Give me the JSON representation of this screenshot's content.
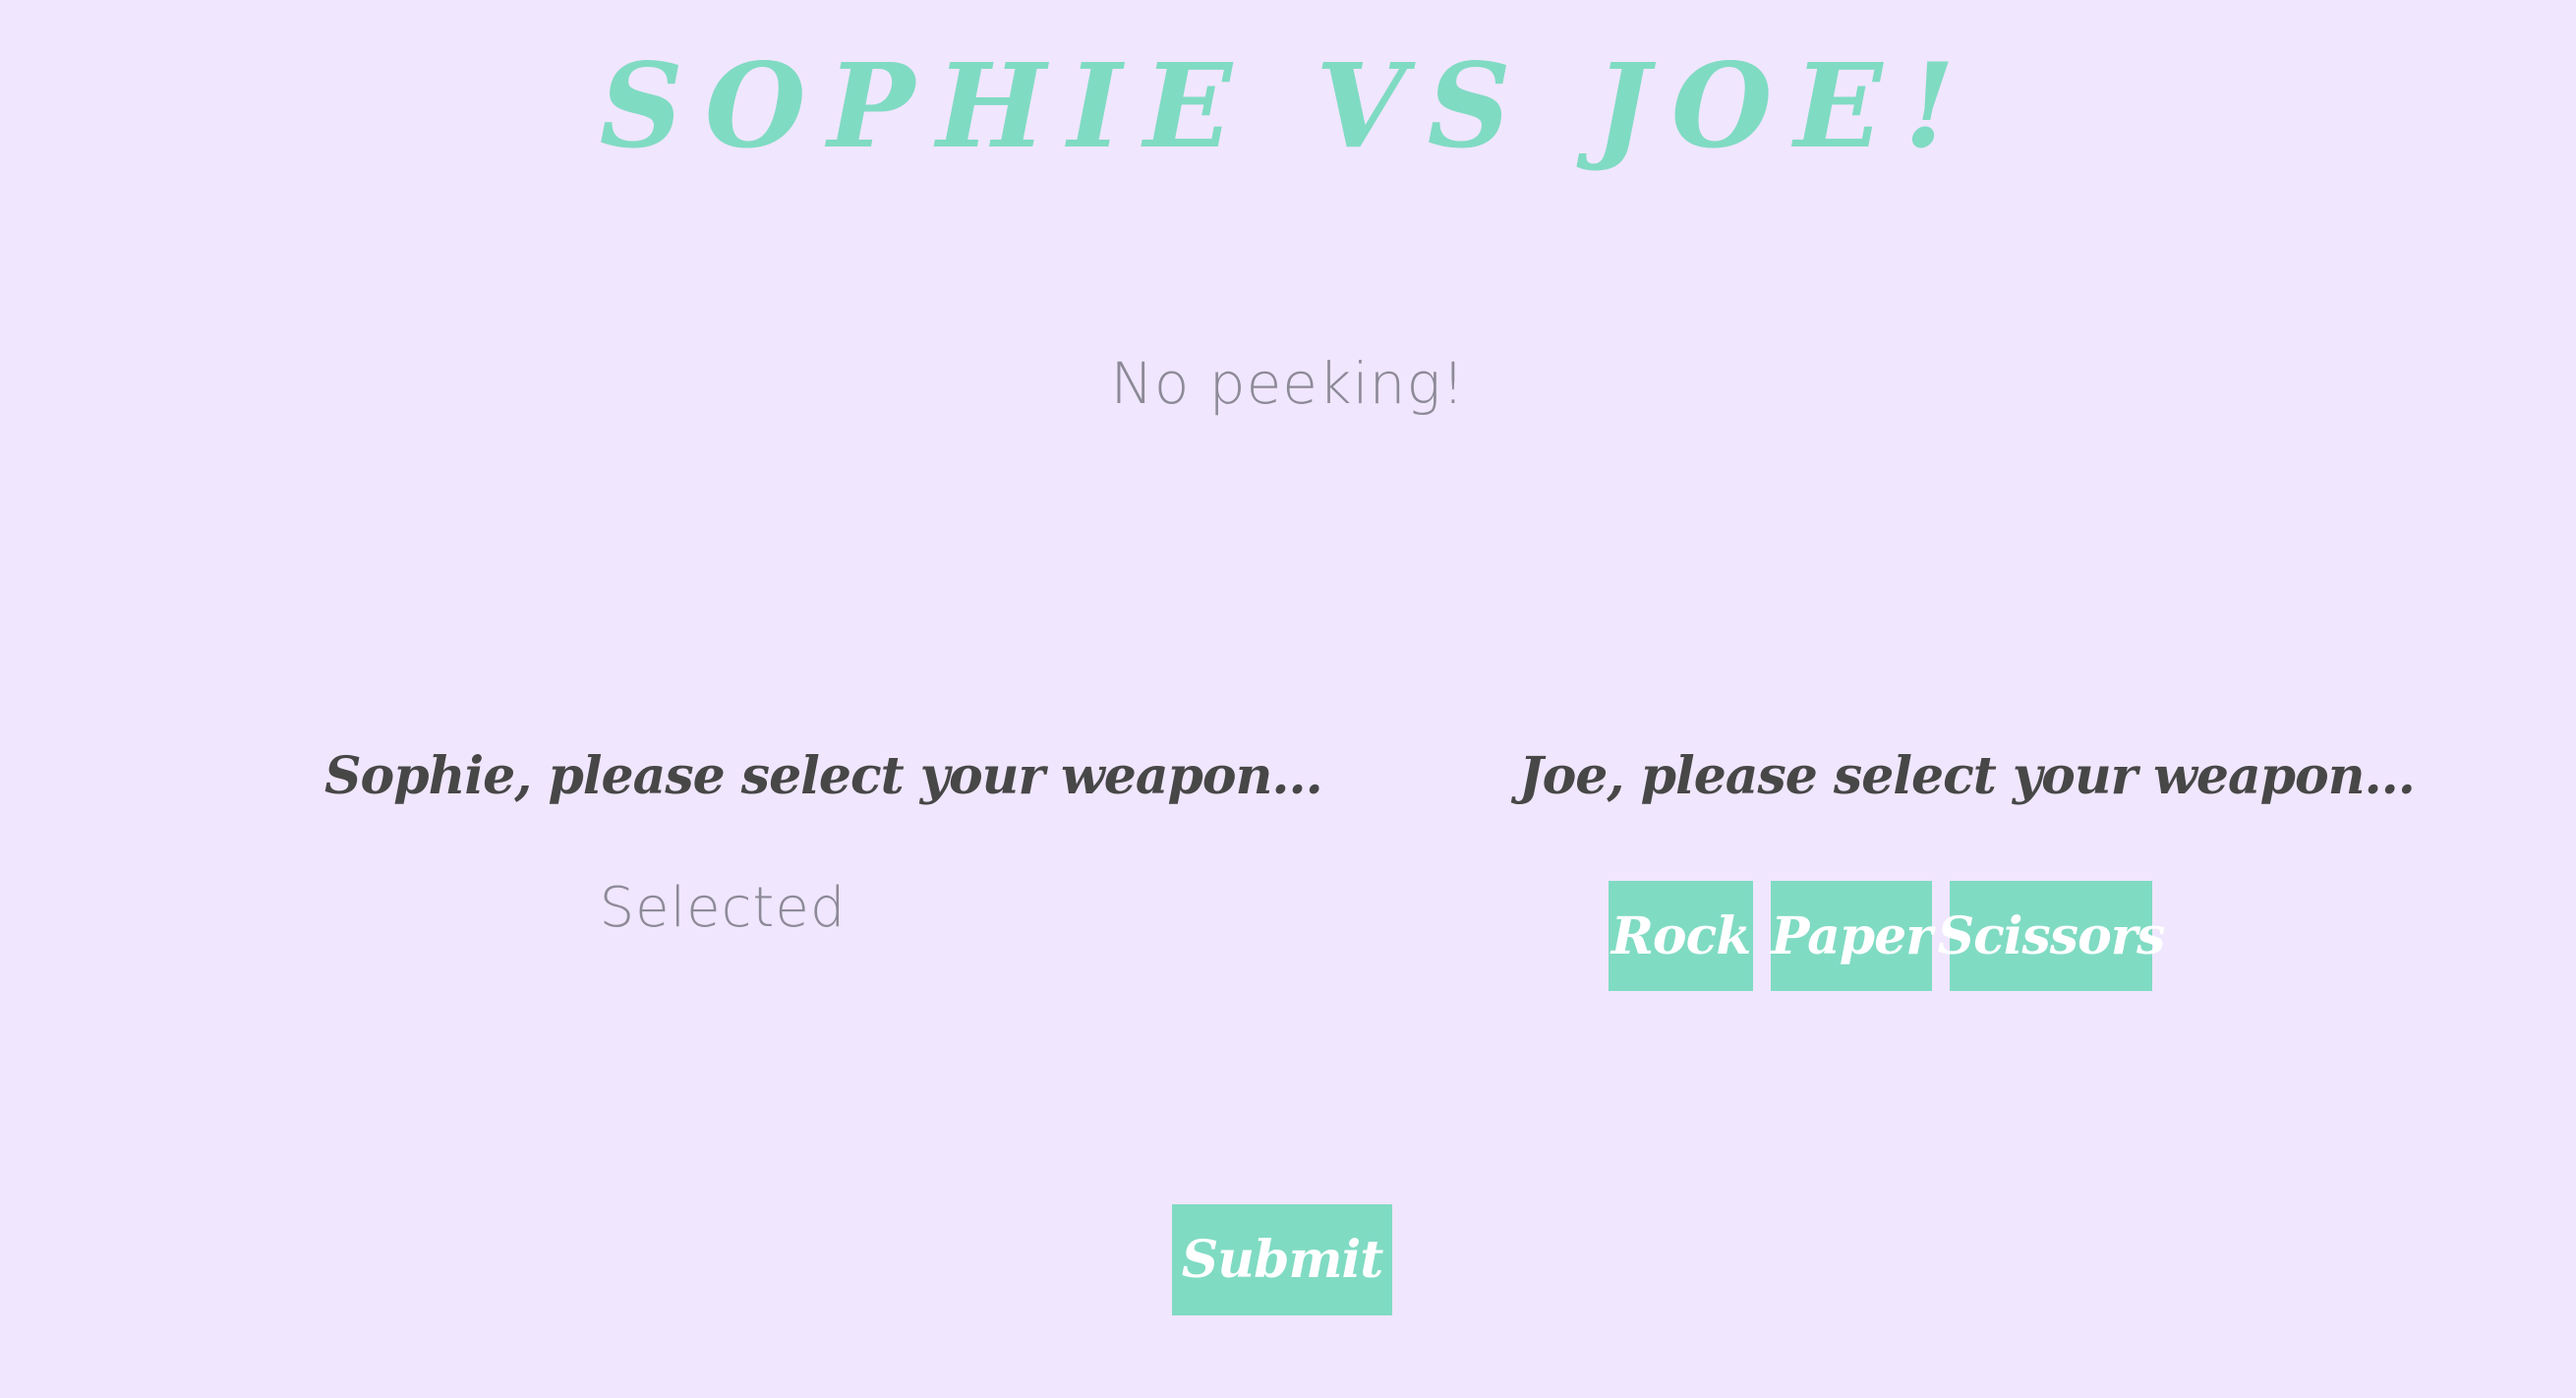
{
  "header": {
    "title": "SOPHIE VS JOE!"
  },
  "notice": {
    "text": "No peeking!"
  },
  "player1": {
    "prompt": "Sophie, please select your weapon...",
    "status": "Selected"
  },
  "player2": {
    "prompt": "Joe, please select your weapon...",
    "weapons": {
      "rock": "Rock",
      "paper": "Paper",
      "scissors": "Scissors"
    }
  },
  "actions": {
    "submit_label": "Submit"
  },
  "colors": {
    "background": "#f0e6fd",
    "accent": "#80dbc3",
    "heading_text": "#474747",
    "muted_text": "#8d8a98",
    "button_text": "#ffffff"
  }
}
